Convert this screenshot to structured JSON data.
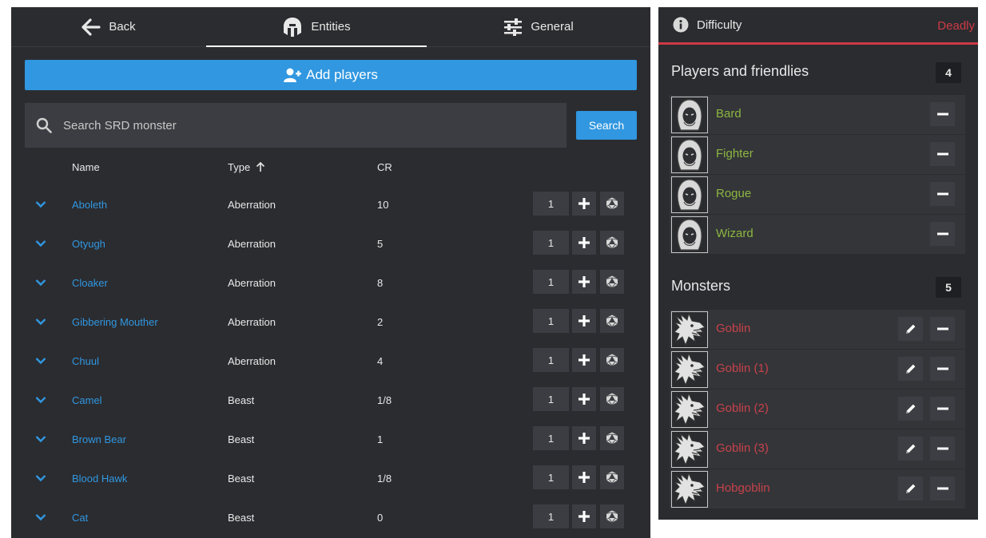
{
  "tabs": {
    "back": "Back",
    "entities": "Entities",
    "general": "General"
  },
  "add_players_label": "Add players",
  "search": {
    "placeholder": "Search SRD monster",
    "button": "Search"
  },
  "table": {
    "col_name": "Name",
    "col_type": "Type",
    "col_cr": "CR",
    "sort": "type-ascending",
    "rows": [
      {
        "name": "Aboleth",
        "type": "Aberration",
        "cr": "10",
        "qty": "1"
      },
      {
        "name": "Otyugh",
        "type": "Aberration",
        "cr": "5",
        "qty": "1"
      },
      {
        "name": "Cloaker",
        "type": "Aberration",
        "cr": "8",
        "qty": "1"
      },
      {
        "name": "Gibbering Mouther",
        "type": "Aberration",
        "cr": "2",
        "qty": "1"
      },
      {
        "name": "Chuul",
        "type": "Aberration",
        "cr": "4",
        "qty": "1"
      },
      {
        "name": "Camel",
        "type": "Beast",
        "cr": "1/8",
        "qty": "1"
      },
      {
        "name": "Brown Bear",
        "type": "Beast",
        "cr": "1",
        "qty": "1"
      },
      {
        "name": "Blood Hawk",
        "type": "Beast",
        "cr": "1/8",
        "qty": "1"
      },
      {
        "name": "Cat",
        "type": "Beast",
        "cr": "0",
        "qty": "1"
      }
    ]
  },
  "difficulty": {
    "title": "Difficulty",
    "value": "Deadly",
    "value_color": "#cc3a44"
  },
  "players": {
    "title": "Players and friendlies",
    "count": "4",
    "items": [
      {
        "name": "Bard"
      },
      {
        "name": "Fighter"
      },
      {
        "name": "Rogue"
      },
      {
        "name": "Wizard"
      }
    ]
  },
  "monsters": {
    "title": "Monsters",
    "count": "5",
    "items": [
      {
        "name": "Goblin"
      },
      {
        "name": "Goblin (1)"
      },
      {
        "name": "Goblin (2)"
      },
      {
        "name": "Goblin (3)"
      },
      {
        "name": "Hobgoblin"
      }
    ]
  },
  "colors": {
    "accent": "#3097e0",
    "player_name": "#8bb740",
    "monster_name": "#c7424a",
    "panel_bg": "#2b2c30"
  },
  "icons": {
    "back": "arrow-left-icon",
    "entities": "helmet-icon",
    "general": "sliders-icon",
    "add_players": "user-plus-icon",
    "search": "search-icon",
    "info": "info-icon",
    "player_avatar": "hooded-figure-icon",
    "monster_avatar": "dragon-head-icon",
    "expand": "chevron-down-icon",
    "add": "plus-icon",
    "roll": "d20-icon",
    "edit": "pencil-icon",
    "remove": "minus-icon"
  }
}
